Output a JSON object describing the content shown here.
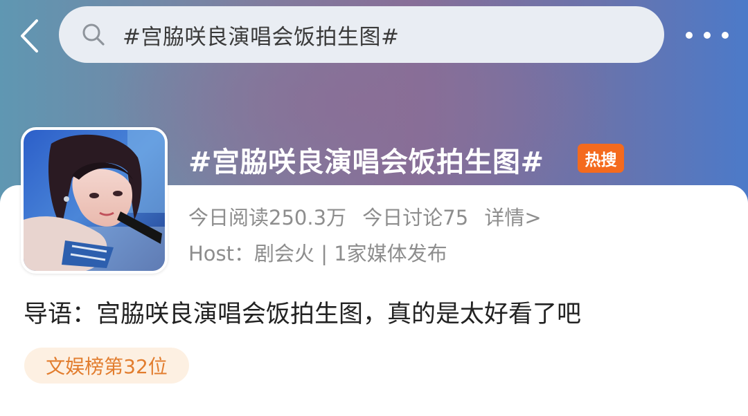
{
  "search": {
    "query": "#宫脇咲良演唱会饭拍生图#"
  },
  "icons": {
    "back": "chevron-left-icon",
    "search": "search-icon",
    "more": "more-dots-icon"
  },
  "topic": {
    "title": "#宫脇咲良演唱会饭拍生图#",
    "hot_badge": "热搜",
    "reads": "今日阅读250.3万",
    "discussions": "今日讨论75",
    "detail_link": "详情>",
    "host": "Host：剧会火 | 1家媒体发布",
    "intro": "导语：宫脇咲良演唱会饭拍生图，真的是太好看了吧",
    "rank_tag": "文娱榜第32位"
  },
  "colors": {
    "hot_badge": "#f46a1e",
    "rank_tag_bg": "#fdf0e2",
    "rank_tag_text": "#e27d2e",
    "meta_text": "#8d8d8d"
  }
}
